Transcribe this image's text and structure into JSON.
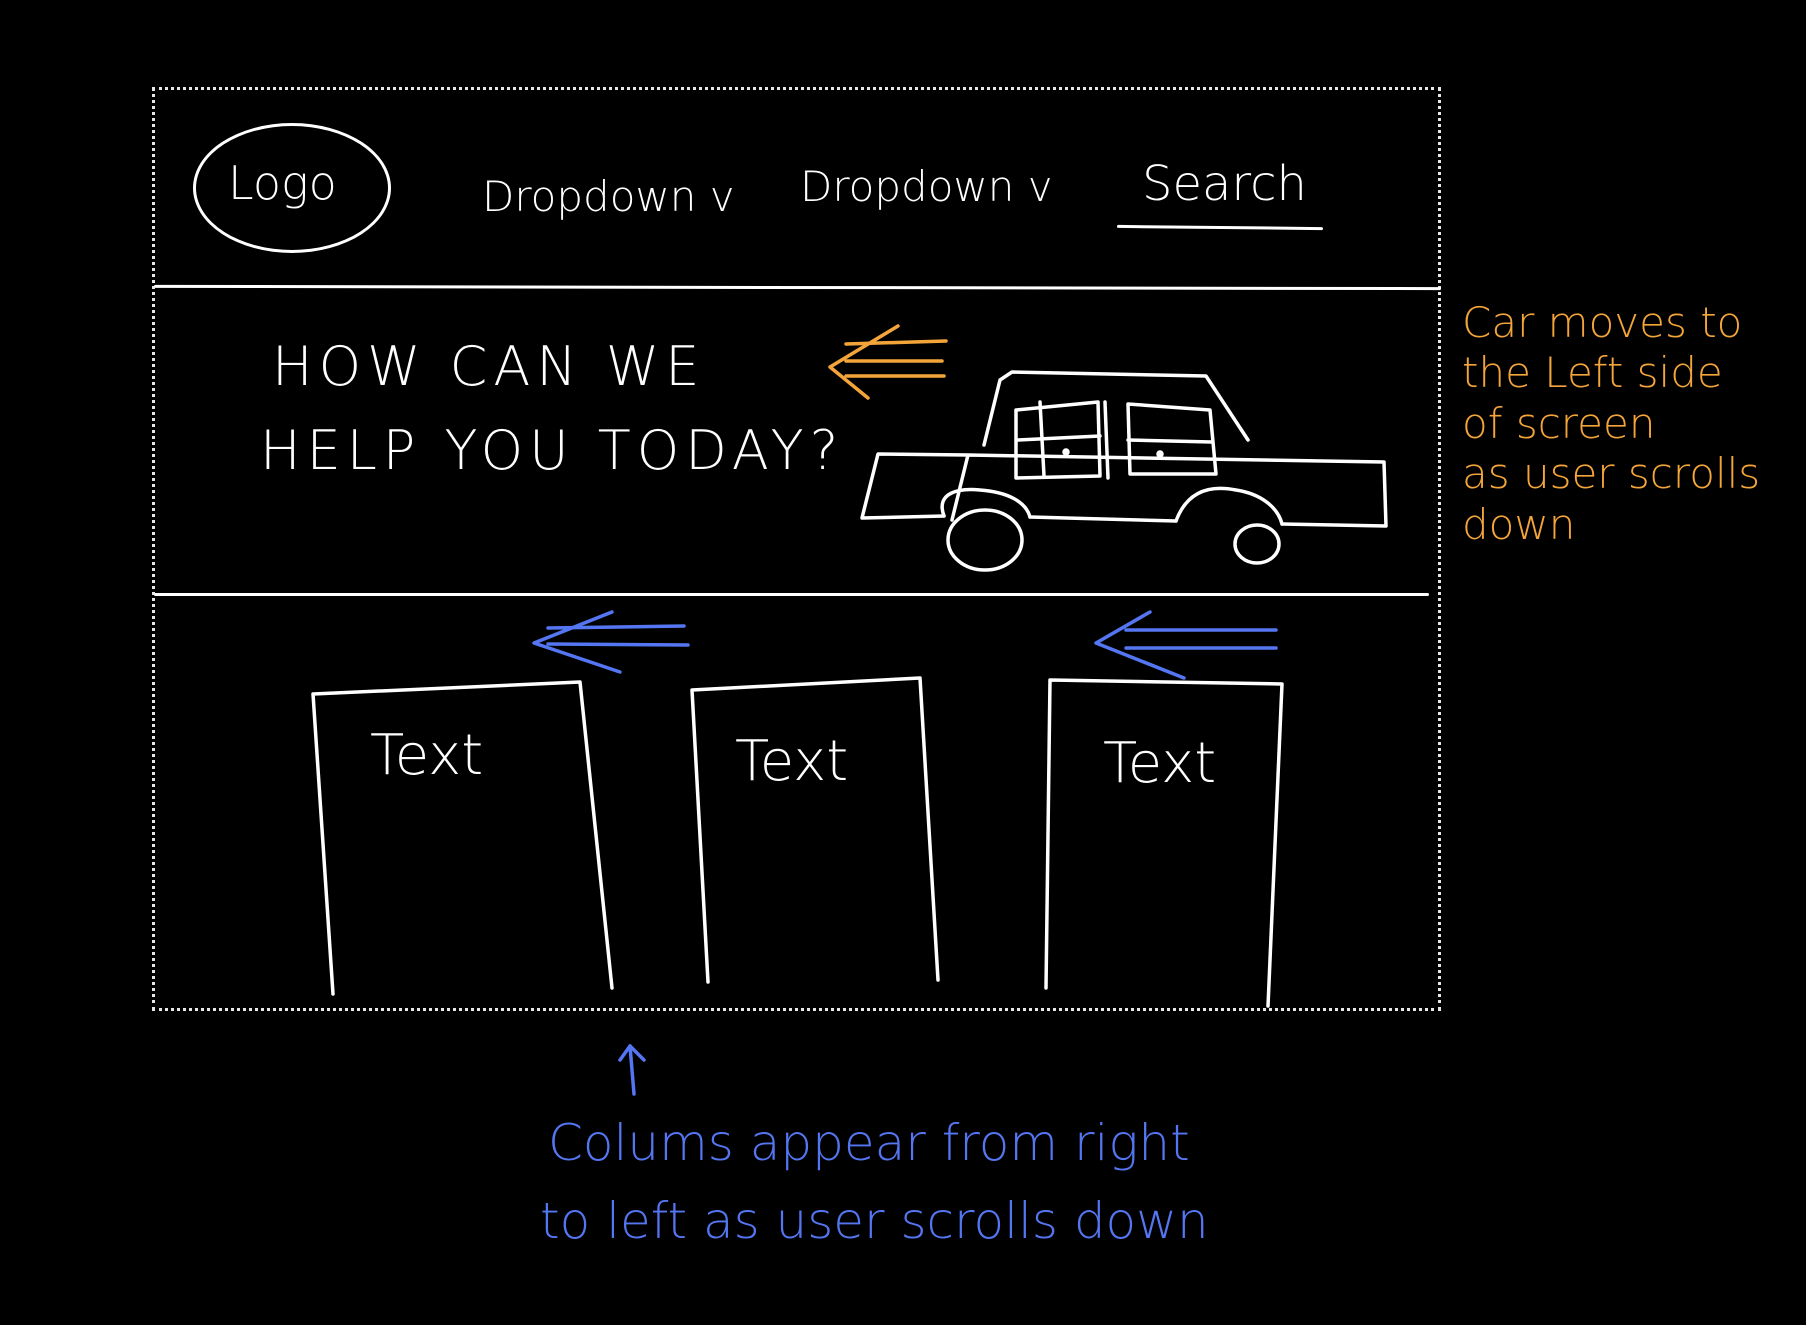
{
  "header": {
    "logo_label": "Logo",
    "dropdown_1_label": "Dropdown v",
    "dropdown_2_label": "Dropdown v",
    "search_label": "Search"
  },
  "hero": {
    "line_1": "HOW CAN WE",
    "line_2": "HELP YOU TODAY?"
  },
  "columns": [
    {
      "label": "Text"
    },
    {
      "label": "Text"
    },
    {
      "label": "Text"
    }
  ],
  "annotations": {
    "car_note": "Car moves to\nthe Left side\nof screen\nas user scrolls\ndown",
    "columns_note_line_1": "Colums appear from right",
    "columns_note_line_2": "to left as user scrolls down"
  },
  "colors": {
    "background": "#000000",
    "sketch": "#ffffff",
    "orange_annotation": "#f4a53a",
    "blue_annotation": "#5576f2"
  },
  "icons": {
    "car": "car-icon",
    "orange_arrow": "left-arrow-icon",
    "blue_arrows": "left-arrow-icon",
    "up_arrow": "up-arrow-icon"
  }
}
